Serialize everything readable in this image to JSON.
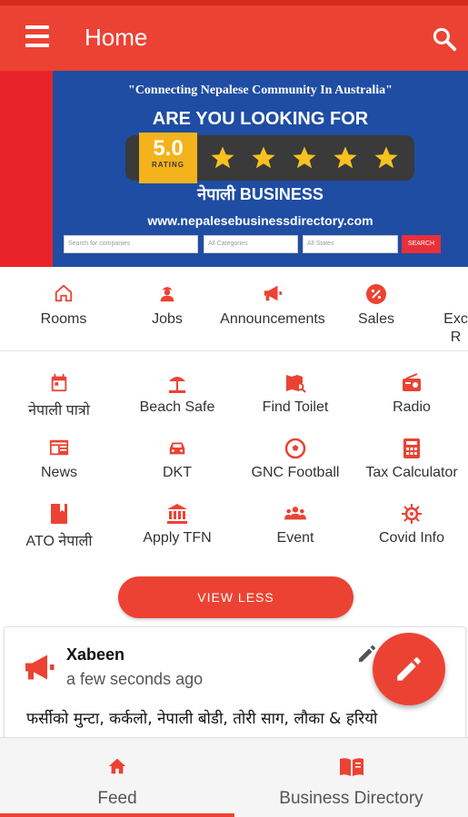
{
  "appbar": {
    "title": "Home",
    "menu_icon": "menu-icon",
    "search_icon": "search-icon",
    "color": "#ec4233"
  },
  "banner": {
    "tagline": "\"Connecting Nepalese Community In Australia\"",
    "heading": "ARE YOU LOOKING FOR",
    "rating_value": "5.0",
    "rating_label": "RATING",
    "stars": 5,
    "subheading": "नेपाली BUSINESS",
    "url": "www.nepalesebusinessdirectory.com",
    "search_placeholder": "Search for companies",
    "category_select": "All Categories",
    "state_select": "All States",
    "search_button": "SEARCH"
  },
  "categories": [
    {
      "label": "Rooms",
      "icon": "home-icon"
    },
    {
      "label": "Jobs",
      "icon": "worker-icon"
    },
    {
      "label": "Announcements",
      "icon": "megaphone-icon"
    },
    {
      "label": "Sales",
      "icon": "discount-icon"
    },
    {
      "label": "Exc R",
      "icon": "exchange-icon"
    }
  ],
  "grid": [
    {
      "label": "नेपाली पात्रो",
      "icon": "calendar-icon"
    },
    {
      "label": "Beach Safe",
      "icon": "beach-umbrella-icon"
    },
    {
      "label": "Find Toilet",
      "icon": "map-search-icon"
    },
    {
      "label": "Radio",
      "icon": "radio-icon"
    },
    {
      "label": "News",
      "icon": "newspaper-icon"
    },
    {
      "label": "DKT",
      "icon": "car-icon"
    },
    {
      "label": "GNC Football",
      "icon": "football-icon"
    },
    {
      "label": "Tax Calculator",
      "icon": "calculator-icon"
    },
    {
      "label": "ATO नेपाली",
      "icon": "book-icon"
    },
    {
      "label": "Apply TFN",
      "icon": "bank-icon"
    },
    {
      "label": "Event",
      "icon": "group-icon"
    },
    {
      "label": "Covid Info",
      "icon": "virus-icon"
    }
  ],
  "view_less_label": "VIEW LESS",
  "post": {
    "author": "Xabeen",
    "time": "a few seconds ago",
    "text": "फर्सीको मुन्टा, कर्कलो, नेपाली बोडी, तोरी साग, लौका & हरियो"
  },
  "bottom_nav": [
    {
      "label": "Feed",
      "icon": "home-icon",
      "active": true
    },
    {
      "label": "Business Directory",
      "icon": "book-open-icon",
      "active": false
    }
  ]
}
